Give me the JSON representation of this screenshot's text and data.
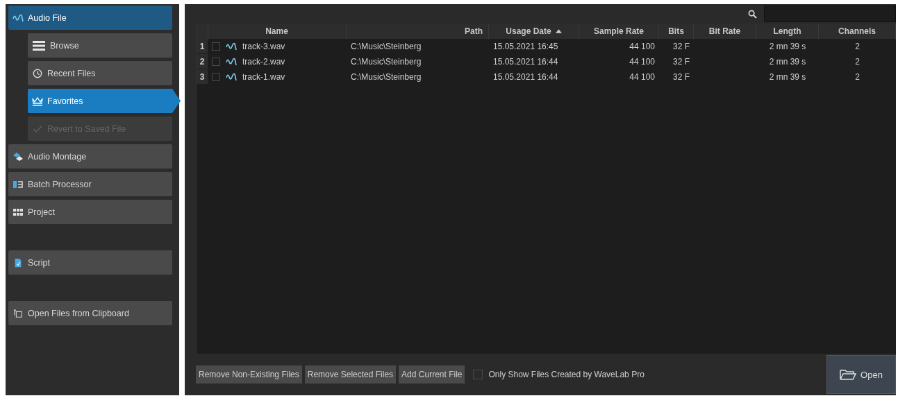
{
  "sidebar": {
    "sections": [
      [
        {
          "label": "Audio File",
          "selected": true,
          "disabled": false,
          "children": [
            {
              "label": "Browse",
              "selected": false,
              "disabled": false
            },
            {
              "label": "Recent Files",
              "selected": false,
              "disabled": false
            },
            {
              "label": "Favorites",
              "selected": true,
              "disabled": false
            },
            {
              "label": "Revert to Saved File",
              "selected": false,
              "disabled": true
            }
          ]
        },
        {
          "label": "Audio Montage",
          "selected": false,
          "disabled": false
        },
        {
          "label": "Batch Processor",
          "selected": false,
          "disabled": false
        },
        {
          "label": "Project",
          "selected": false,
          "disabled": false
        }
      ],
      [
        {
          "label": "Script",
          "selected": false,
          "disabled": false
        }
      ],
      [
        {
          "label": "Open Files from Clipboard",
          "selected": false,
          "disabled": false
        }
      ]
    ]
  },
  "table": {
    "columns": [
      {
        "label": "Name",
        "sorted": false
      },
      {
        "label": "Path",
        "sorted": false
      },
      {
        "label": "Usage Date",
        "sorted": true
      },
      {
        "label": "Sample Rate",
        "sorted": false
      },
      {
        "label": "Bits",
        "sorted": false
      },
      {
        "label": "Bit Rate",
        "sorted": false
      },
      {
        "label": "Length",
        "sorted": false
      },
      {
        "label": "Channels",
        "sorted": false
      }
    ],
    "rows": [
      {
        "number": "1",
        "checked": false,
        "name": "track-3.wav",
        "path": "C:\\Music\\Steinberg",
        "usage_date": "15.05.2021 16:45",
        "sample_rate": "44 100",
        "bits": "32 F",
        "length": "2 mn 39 s",
        "channels": "2"
      },
      {
        "number": "2",
        "checked": false,
        "name": "track-2.wav",
        "path": "C:\\Music\\Steinberg",
        "usage_date": "15.05.2021 16:44",
        "sample_rate": "44 100",
        "bits": "32 F",
        "length": "2 mn 39 s",
        "channels": "2"
      },
      {
        "number": "3",
        "checked": false,
        "name": "track-1.wav",
        "path": "C:\\Music\\Steinberg",
        "usage_date": "15.05.2021 16:44",
        "sample_rate": "44 100",
        "bits": "32 F",
        "length": "2 mn 39 s",
        "channels": "2"
      }
    ]
  },
  "bottom_bar": {
    "buttons": [
      "Remove Non-Existing Files",
      "Remove Selected Files",
      "Add Current File"
    ],
    "checkbox": {
      "label": "Only Show Files Created by WaveLab Pro",
      "checked": false
    },
    "open_button": "Open"
  }
}
